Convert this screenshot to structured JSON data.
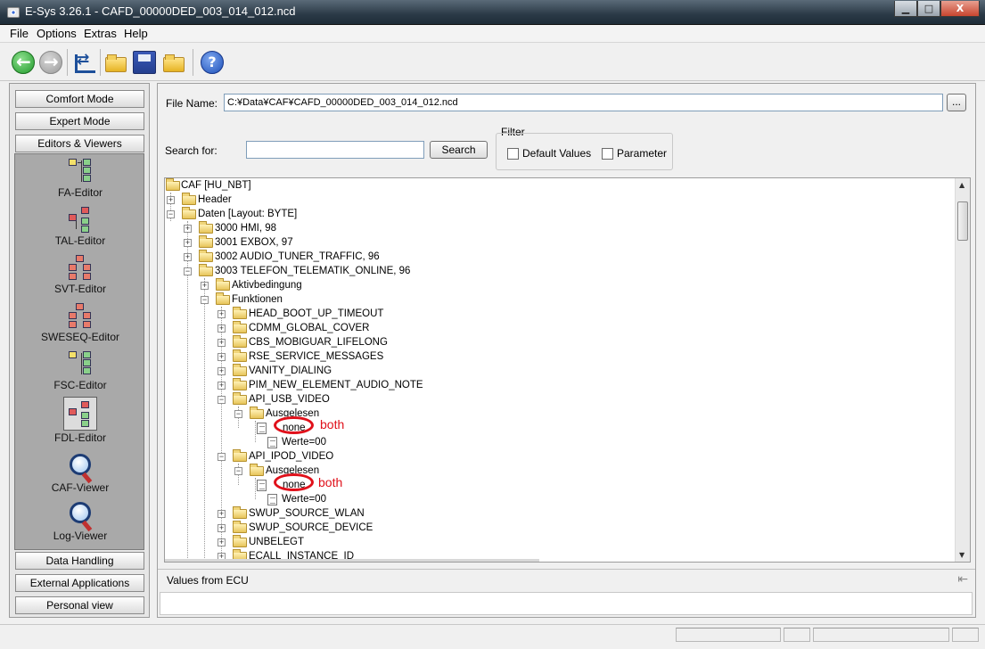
{
  "window": {
    "title": "E-Sys 3.26.1 - CAFD_00000DED_003_014_012.ncd",
    "buttons": {
      "minimize": "▁",
      "maximize": "□",
      "close": "X"
    }
  },
  "menu": [
    "File",
    "Options",
    "Extras",
    "Help"
  ],
  "toolbar": {
    "icons": [
      "back-icon",
      "forward-icon",
      "connect-icon",
      "open-folder-icon",
      "save-icon",
      "open-file-icon",
      "help-icon"
    ],
    "help_glyph": "?"
  },
  "sidebar": {
    "modes_top": [
      "Comfort Mode",
      "Expert Mode",
      "Editors & Viewers"
    ],
    "tools": [
      "FA-Editor",
      "TAL-Editor",
      "SVT-Editor",
      "SWESEQ-Editor",
      "FSC-Editor",
      "FDL-Editor",
      "CAF-Viewer",
      "Log-Viewer"
    ],
    "modes_bottom": [
      "Data Handling",
      "External Applications",
      "Personal view"
    ]
  },
  "main": {
    "file_name_label": "File Name:",
    "file_name_value": "C:¥Data¥CAF¥CAFD_00000DED_003_014_012.ncd",
    "browse_label": "...",
    "search_label": "Search for:",
    "search_value": "",
    "search_button": "Search",
    "filter": {
      "title": "Filter",
      "default_values": "Default Values",
      "parameter": "Parameter"
    }
  },
  "tree": {
    "rows": [
      "CAF [HU_NBT]",
      "Header",
      "Daten [Layout: BYTE]",
      "3000 HMI, 98",
      "3001 EXBOX, 97",
      "3002 AUDIO_TUNER_TRAFFIC, 96",
      "3003 TELEFON_TELEMATIK_ONLINE, 96",
      "Aktivbedingung",
      "Funktionen",
      "HEAD_BOOT_UP_TIMEOUT",
      "CDMM_GLOBAL_COVER",
      "CBS_MOBIGUAR_LIFELONG",
      "RSE_SERVICE_MESSAGES",
      "VANITY_DIALING",
      "PIM_NEW_ELEMENT_AUDIO_NOTE",
      "API_USB_VIDEO",
      "Ausgelesen",
      "none",
      "Werte=00",
      "API_IPOD_VIDEO",
      "Ausgelesen",
      "none",
      "Werte=00",
      "SWUP_SOURCE_WLAN",
      "SWUP_SOURCE_DEVICE",
      "UNBELEGT",
      "ECALL_INSTANCE_ID"
    ],
    "annotations": [
      "both",
      "both"
    ]
  },
  "bottom": {
    "values_title": "Values from ECU"
  },
  "colors": {
    "annotation": "#e0101a",
    "titlebar": "#2b3a47"
  }
}
